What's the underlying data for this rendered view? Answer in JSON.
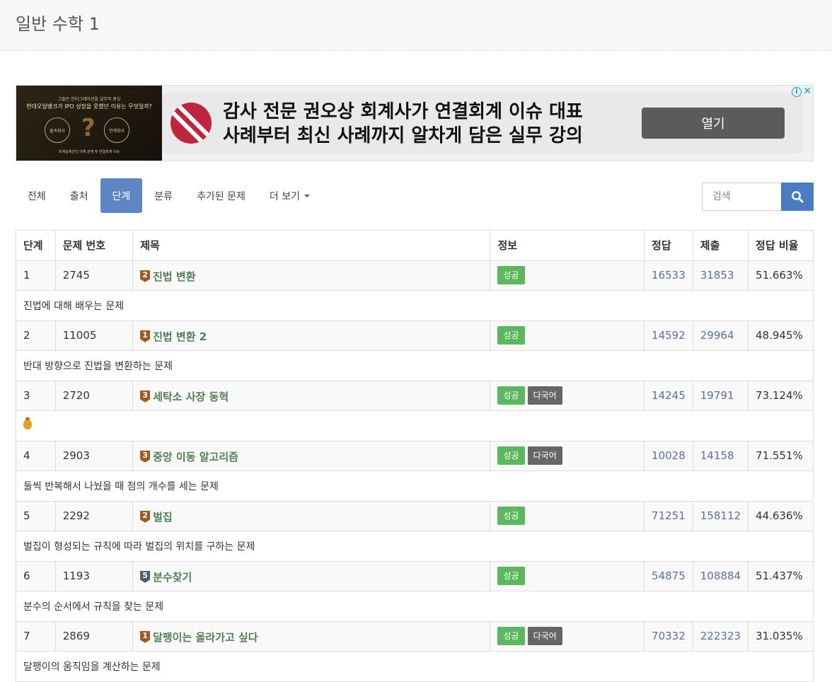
{
  "header": {
    "title": "일반 수학 1"
  },
  "ad": {
    "left_line1": "그들은 인터그레이션을 실무의 중심",
    "left_line2": "현대오일뱅크가 IPO 성장을 못했던 이유는 무엇일까?",
    "left_circle1": "출속회사",
    "left_circle2": "연계회사",
    "left_line3": "회계실체간의 이해 관계 및 연결회계 이슈",
    "headline1": "감사 전문 권오상 회계사가 연결회계 이슈 대표",
    "headline2": "사례부터 최신 사례까지 알차게 담은 실무 강의",
    "button": "열기",
    "info": "i",
    "close": "✕"
  },
  "tabs": [
    {
      "label": "전체",
      "active": false
    },
    {
      "label": "출처",
      "active": false
    },
    {
      "label": "단계",
      "active": true
    },
    {
      "label": "분류",
      "active": false
    },
    {
      "label": "추가된 문제",
      "active": false
    },
    {
      "label": "더 보기",
      "active": false
    }
  ],
  "search": {
    "placeholder": "검색",
    "icon": "search-icon"
  },
  "table": {
    "headers": [
      "단계",
      "문제 번호",
      "제목",
      "정보",
      "정답",
      "제출",
      "정답 비율"
    ],
    "rows": [
      {
        "step": "1",
        "id": "2745",
        "tier": "2",
        "tier_color": "bronze",
        "title": "진법 변환",
        "labels": [
          "성공"
        ],
        "correct": "16533",
        "submit": "31853",
        "ratio": "51.663%",
        "desc": "진법에 대해 배우는 문제"
      },
      {
        "step": "2",
        "id": "11005",
        "tier": "1",
        "tier_color": "bronze",
        "title": "진법 변환 2",
        "labels": [
          "성공"
        ],
        "correct": "14592",
        "submit": "29964",
        "ratio": "48.945%",
        "desc": "반대 방향으로 진법을 변환하는 문제"
      },
      {
        "step": "3",
        "id": "2720",
        "tier": "3",
        "tier_color": "bronze",
        "title": "세탁소 사장 동혁",
        "labels": [
          "성공",
          "다국어"
        ],
        "correct": "14245",
        "submit": "19791",
        "ratio": "73.124%",
        "desc": ""
      },
      {
        "step": "4",
        "id": "2903",
        "tier": "3",
        "tier_color": "bronze",
        "title": "중앙 이동 알고리즘",
        "labels": [
          "성공",
          "다국어"
        ],
        "correct": "10028",
        "submit": "14158",
        "ratio": "71.551%",
        "desc": "둘씩 반복해서 나눴을 때 점의 개수를 세는 문제"
      },
      {
        "step": "5",
        "id": "2292",
        "tier": "2",
        "tier_color": "bronze",
        "title": "벌집",
        "labels": [
          "성공"
        ],
        "correct": "71251",
        "submit": "158112",
        "ratio": "44.636%",
        "desc": "벌집이 형성되는 규칙에 따라 벌집의 위치를 구하는 문제"
      },
      {
        "step": "6",
        "id": "1193",
        "tier": "5",
        "tier_color": "platinum",
        "title": "분수찾기",
        "labels": [
          "성공"
        ],
        "correct": "54875",
        "submit": "108884",
        "ratio": "51.437%",
        "desc": "분수의 순서에서 규칙을 찾는 문제"
      },
      {
        "step": "7",
        "id": "2869",
        "tier": "1",
        "tier_color": "bronze",
        "title": "달팽이는 올라가고 싶다",
        "labels": [
          "성공",
          "다국어"
        ],
        "correct": "70332",
        "submit": "222323",
        "ratio": "31.035%",
        "desc": "달팽이의 움직임을 계산하는 문제"
      }
    ]
  },
  "colors": {
    "accent": "#5c86c6",
    "success": "#5cb85c",
    "multilang": "#666666",
    "link": "#5a6fa6",
    "title": "#527f5a"
  }
}
